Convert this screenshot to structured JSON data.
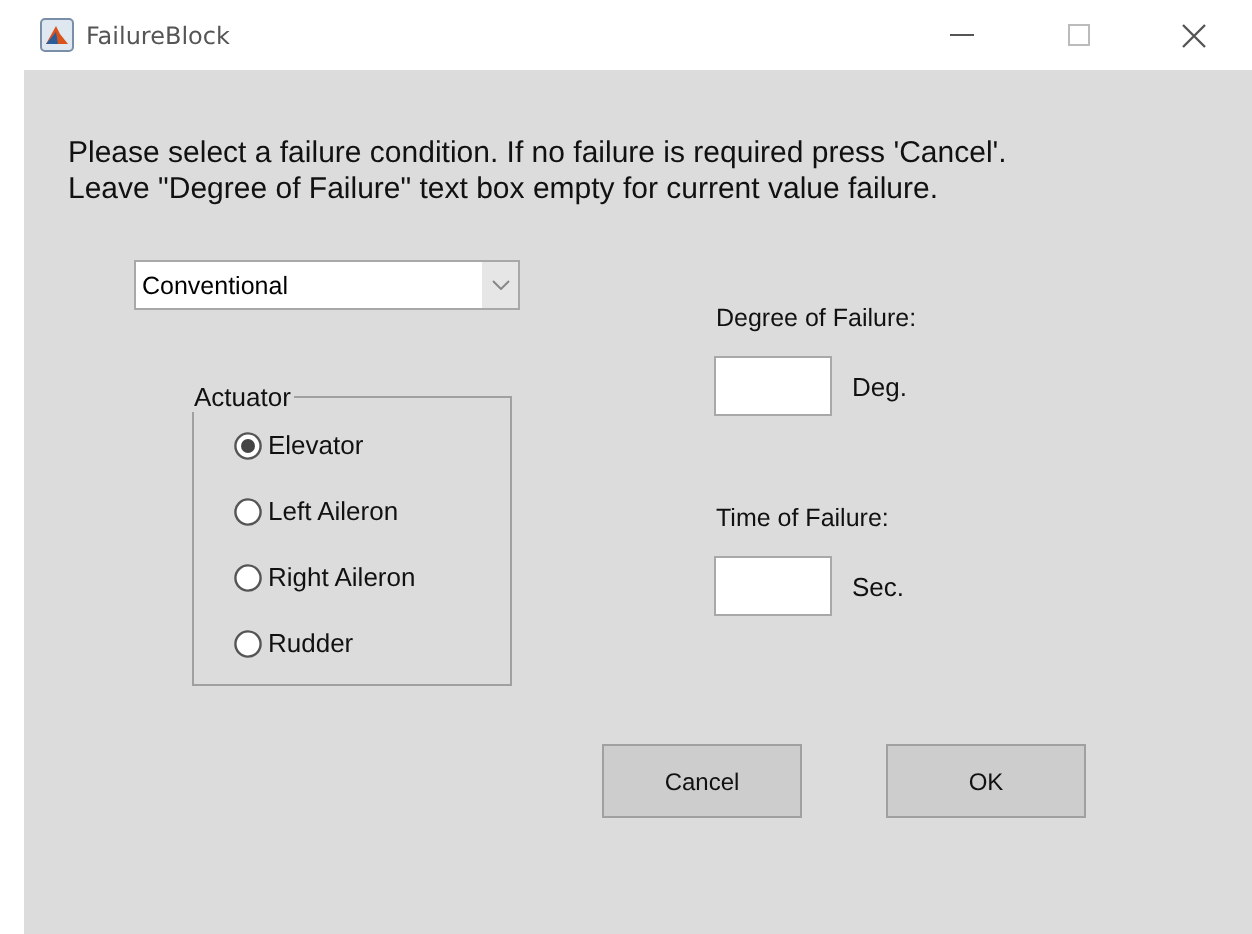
{
  "window": {
    "title": "FailureBlock"
  },
  "instructions": [
    "Please select a failure condition. If no failure is required press 'Cancel'.",
    "Leave \"Degree of Failure\" text box empty for current value failure."
  ],
  "dropdown": {
    "value": "Conventional"
  },
  "actuator": {
    "title": "Actuator",
    "options": [
      {
        "label": "Elevator",
        "selected": true
      },
      {
        "label": "Left Aileron",
        "selected": false
      },
      {
        "label": "Right Aileron",
        "selected": false
      },
      {
        "label": "Rudder",
        "selected": false
      }
    ]
  },
  "fields": [
    {
      "label": "Degree of Failure:",
      "unit": "Deg."
    },
    {
      "label": "Time of Failure:",
      "unit": "Sec."
    }
  ],
  "buttons": [
    "Cancel",
    "OK"
  ]
}
